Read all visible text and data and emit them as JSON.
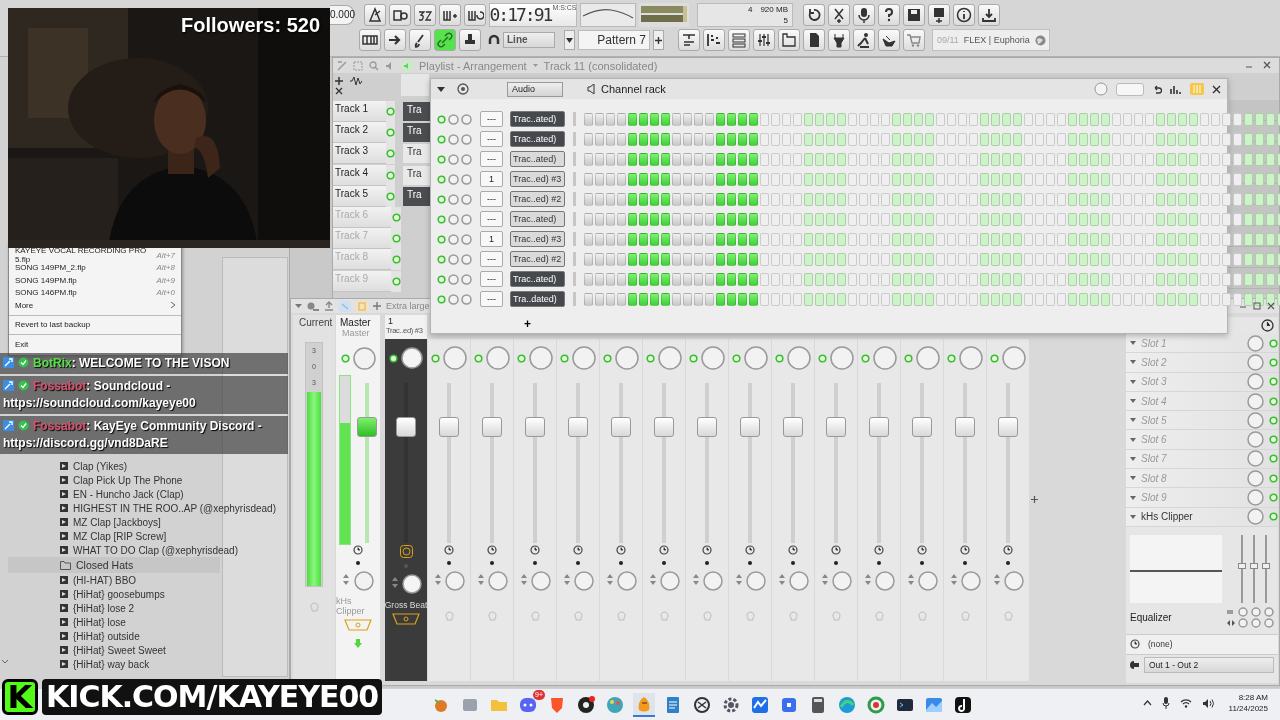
{
  "toolbar": {
    "tempo": "0.000",
    "time": "0:17:91",
    "time_unit": "M:S:CS",
    "cpu": "4",
    "memory": "920 MB",
    "polyphony": "5",
    "link_button": {
      "on": true
    },
    "snap": "Line",
    "pattern": "Pattern 7",
    "news_index": "09/11",
    "news": "FLEX | Euphoria"
  },
  "playlist": {
    "title": "Playlist - Arrangement",
    "crumb": "Track 11 (consolidated)",
    "tracks": [
      {
        "name": "Track 1",
        "empty": false,
        "clip": {
          "label": "Tra",
          "selected": true
        }
      },
      {
        "name": "Track 2",
        "empty": false,
        "clip": {
          "label": "Tra",
          "selected": true
        }
      },
      {
        "name": "Track 3",
        "empty": false,
        "clip": {
          "label": "Tra",
          "selected": false
        }
      },
      {
        "name": "Track 4",
        "empty": false,
        "clip": {
          "label": "Tra",
          "selected": false
        }
      },
      {
        "name": "Track 5",
        "empty": false,
        "clip": {
          "label": "Tra",
          "selected": true
        }
      },
      {
        "name": "Track 6",
        "empty": true
      },
      {
        "name": "Track 7",
        "empty": true
      },
      {
        "name": "Track 8",
        "empty": true
      },
      {
        "name": "Track 9",
        "empty": true
      }
    ]
  },
  "channel_rack": {
    "title": "Channel rack",
    "group": "Audio",
    "add": "+",
    "channels": [
      {
        "number": "---",
        "name": "Trac..ated)",
        "selected": true,
        "steps": [
          false,
          false,
          false,
          false,
          true,
          true,
          true,
          true,
          false,
          false,
          false,
          false,
          true,
          true,
          true,
          true
        ]
      },
      {
        "number": "---",
        "name": "Trac..ated)",
        "selected": true,
        "steps": [
          false,
          false,
          false,
          false,
          true,
          true,
          true,
          true,
          false,
          false,
          false,
          false,
          true,
          true,
          true,
          true
        ]
      },
      {
        "number": "---",
        "name": "Trac..ated)",
        "selected": false,
        "steps": [
          false,
          false,
          false,
          false,
          true,
          true,
          true,
          true,
          false,
          false,
          false,
          false,
          true,
          true,
          true,
          true
        ]
      },
      {
        "number": "1",
        "name": "Trac..ed) #3",
        "selected": false,
        "steps": [
          false,
          false,
          false,
          false,
          true,
          true,
          true,
          true,
          false,
          false,
          false,
          false,
          true,
          true,
          true,
          true
        ]
      },
      {
        "number": "---",
        "name": "Trac..ed) #2",
        "selected": false,
        "steps": [
          false,
          false,
          false,
          false,
          true,
          true,
          true,
          true,
          false,
          false,
          false,
          false,
          true,
          true,
          true,
          true
        ]
      },
      {
        "number": "---",
        "name": "Trac..ated)",
        "selected": false,
        "steps": [
          false,
          false,
          false,
          false,
          true,
          true,
          true,
          true,
          false,
          false,
          false,
          false,
          true,
          true,
          true,
          true
        ]
      },
      {
        "number": "1",
        "name": "Trac..ed) #3",
        "selected": false,
        "steps": [
          false,
          false,
          false,
          false,
          true,
          true,
          true,
          true,
          false,
          false,
          false,
          false,
          true,
          true,
          true,
          true
        ]
      },
      {
        "number": "---",
        "name": "Trac..ed) #2",
        "selected": false,
        "steps": [
          false,
          false,
          false,
          false,
          true,
          true,
          true,
          true,
          false,
          false,
          false,
          false,
          true,
          true,
          true,
          true
        ]
      },
      {
        "number": "---",
        "name": "Trac..ated)",
        "selected": true,
        "steps": [
          false,
          false,
          false,
          false,
          true,
          true,
          true,
          true,
          false,
          false,
          false,
          false,
          true,
          true,
          true,
          true
        ]
      },
      {
        "number": "---",
        "name": "Tra..dated)",
        "selected": true,
        "steps": [
          false,
          false,
          false,
          false,
          true,
          true,
          true,
          true,
          false,
          false,
          false,
          false,
          true,
          true,
          true,
          true
        ]
      }
    ]
  },
  "mixer": {
    "zoom": "Extra large",
    "current": {
      "label": "Current",
      "ticks": [
        "3",
        "0",
        "3"
      ],
      "level": 0.8
    },
    "master": {
      "name": "Master",
      "subname": "Master",
      "plugin": "kHs Clipper",
      "meter": {
        "level": 0.72
      },
      "fader": {
        "level": 0.76
      }
    },
    "inserts": [
      {
        "number": "1",
        "name": "Trac..ed) #3",
        "plugin": "Gross Beat",
        "selected": true,
        "fader": {
          "level": 0.76
        }
      },
      {
        "selected": false,
        "fader": {
          "level": 0.76
        }
      },
      {
        "selected": false,
        "fader": {
          "level": 0.76
        }
      },
      {
        "selected": false,
        "fader": {
          "level": 0.76
        }
      },
      {
        "selected": false,
        "fader": {
          "level": 0.76
        }
      },
      {
        "selected": false,
        "fader": {
          "level": 0.76
        }
      },
      {
        "selected": false,
        "fader": {
          "level": 0.76
        }
      },
      {
        "selected": false,
        "fader": {
          "level": 0.76
        }
      },
      {
        "selected": false,
        "fader": {
          "level": 0.76
        }
      },
      {
        "selected": false,
        "fader": {
          "level": 0.76
        }
      },
      {
        "selected": false,
        "fader": {
          "level": 0.76
        }
      },
      {
        "selected": false,
        "fader": {
          "level": 0.76
        }
      },
      {
        "selected": false,
        "fader": {
          "level": 0.76
        }
      },
      {
        "selected": false,
        "fader": {
          "level": 0.76
        }
      },
      {
        "selected": false,
        "fader": {
          "level": 0.76
        }
      }
    ],
    "slots": [
      {
        "name": "Slot 1",
        "filled": false
      },
      {
        "name": "Slot 2",
        "filled": false
      },
      {
        "name": "Slot 3",
        "filled": false
      },
      {
        "name": "Slot 4",
        "filled": false
      },
      {
        "name": "Slot 5",
        "filled": false
      },
      {
        "name": "Slot 6",
        "filled": false
      },
      {
        "name": "Slot 7",
        "filled": false
      },
      {
        "name": "Slot 8",
        "filled": false
      },
      {
        "name": "Slot 9",
        "filled": false
      },
      {
        "name": "kHs Clipper",
        "filled": true
      }
    ],
    "eq_bands": [
      {
        "level": 0.55
      },
      {
        "level": 0.55
      },
      {
        "level": 0.55
      }
    ],
    "eq_label": "Equalizer",
    "input": "(none)",
    "output": "Out 1 - Out 2"
  },
  "browser": {
    "menu": [
      {
        "kind": "file",
        "label": "KAYEYE VOCAL RECORDING PRO 5.flp",
        "shortcut": "Alt+7"
      },
      {
        "kind": "file",
        "label": "SONG 149PM_2.flp",
        "shortcut": "Alt+8"
      },
      {
        "kind": "file",
        "label": "SONG 149PM.flp",
        "shortcut": "Alt+9"
      },
      {
        "kind": "file",
        "label": "SONG 146PM.flp",
        "shortcut": "Alt+0"
      },
      {
        "kind": "submenu",
        "label": "More"
      },
      {
        "kind": "action",
        "label": "Revert to last backup"
      },
      {
        "kind": "action",
        "label": "Exit"
      }
    ],
    "items": [
      {
        "kind": "file",
        "label": "Clap (Yikes)"
      },
      {
        "kind": "file",
        "label": "Clap Pick Up The Phone"
      },
      {
        "kind": "file",
        "label": "EN - Huncho Jack (Clap)"
      },
      {
        "kind": "file",
        "label": "HIGHEST IN THE ROO..AP (@xephyrisdead)"
      },
      {
        "kind": "file",
        "label": "MZ Clap [Jackboys]"
      },
      {
        "kind": "file",
        "label": "MZ Clap [RIP Screw]"
      },
      {
        "kind": "file",
        "label": "WHAT TO DO Clap (@xephyrisdead)"
      },
      {
        "kind": "folder",
        "label": "Closed Hats"
      },
      {
        "kind": "file",
        "label": "(HI-HAT) BBO"
      },
      {
        "kind": "file",
        "label": "{HiHat} goosebumps"
      },
      {
        "kind": "file",
        "label": "{HiHat} lose 2"
      },
      {
        "kind": "file",
        "label": "{HiHat} lose"
      },
      {
        "kind": "file",
        "label": "{HiHat} outside"
      },
      {
        "kind": "file",
        "label": "{HiHat} Sweet Sweet"
      },
      {
        "kind": "file",
        "label": "{HiHat} way back"
      }
    ]
  },
  "stream": {
    "followers": "Followers: 520",
    "chat": [
      {
        "user": "BotRix",
        "color": "#58e04a",
        "text": ": WELCOME TO THE VISON"
      },
      {
        "user": "Fossabot",
        "color": "#d9506e",
        "text": ": Soundcloud - https://soundcloud.com/kayeye00"
      },
      {
        "user": "Fossabot",
        "color": "#d9506e",
        "text": ": KayEye Community Discord - https://discord.gg/vnd8DaRE"
      }
    ],
    "banner_logo": "K",
    "banner": "KICK.COM/KAYEYE00"
  },
  "taskbar": {
    "badge": "9+",
    "time": "8:28 AM",
    "date": "11/24/2025"
  }
}
